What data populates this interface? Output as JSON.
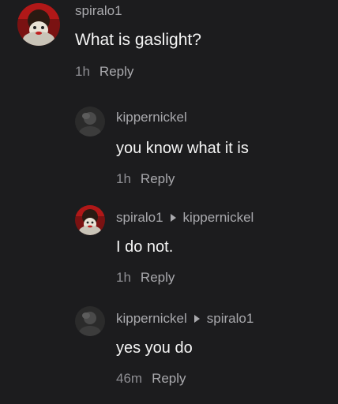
{
  "comments": [
    {
      "username": "spiralo1",
      "reply_to": "",
      "text": "What is gaslight?",
      "time": "1h",
      "reply_label": "Reply",
      "avatar_icon": "clown-avatar-icon"
    },
    {
      "username": "kippernickel",
      "reply_to": "",
      "text": "you know what it is",
      "time": "1h",
      "reply_label": "Reply",
      "avatar_icon": "dark-avatar-icon"
    },
    {
      "username": "spiralo1",
      "reply_to": "kippernickel",
      "text": "I do not.",
      "time": "1h",
      "reply_label": "Reply",
      "avatar_icon": "clown-avatar-icon"
    },
    {
      "username": "kippernickel",
      "reply_to": "spiralo1",
      "text": "yes you do",
      "time": "46m",
      "reply_label": "Reply",
      "avatar_icon": "dark-avatar-icon"
    }
  ],
  "colors": {
    "background": "#1c1c1e",
    "username": "#a9a9ad",
    "text": "#f5f5f5",
    "meta": "#8e8e93"
  }
}
